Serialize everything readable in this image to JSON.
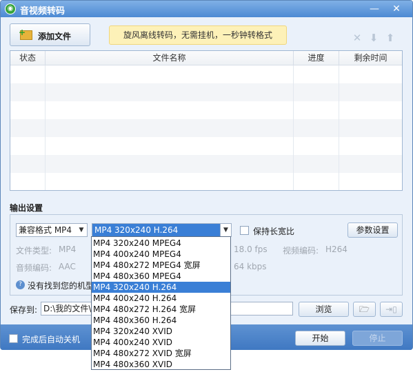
{
  "window": {
    "title": "音视频转码",
    "minimize_label": "—",
    "close_label": "✕"
  },
  "toolbar": {
    "add_files_label": "添加文件",
    "banner_text": "旋风离线转码，无需挂机，一秒钟转格式",
    "delete_icon": "close-icon",
    "move_down_icon": "arrow-down-icon",
    "move_up_icon": "arrow-up-icon"
  },
  "file_table": {
    "columns": [
      "状态",
      "文件名称",
      "进度",
      "剩余时间"
    ],
    "rows": []
  },
  "output_settings": {
    "section_title": "输出设置",
    "format_category": "兼容格式 MP4",
    "format_preset": "MP4 320x240 H.264",
    "keep_aspect_label": "保持长宽比",
    "params_button": "参数设置",
    "file_type_label": "文件类型:",
    "file_type_value": "MP4",
    "audio_codec_label": "音频编码:",
    "audio_codec_value": "AAC",
    "framerate_value": "18.0 fps",
    "video_codec_label": "视频编码:",
    "video_codec_value": "H264",
    "bitrate_value": "64 kbps",
    "help_text": "没有找到您的机型"
  },
  "save": {
    "label": "保存到:",
    "path": "D:\\我的文件\\",
    "browse_button": "浏览",
    "open_folder_icon": "folder-icon",
    "export_icon": "export-icon"
  },
  "bottom": {
    "auto_shutdown_label": "完成后自动关机",
    "start_button": "开始",
    "stop_button": "停止"
  },
  "preset_dropdown": {
    "selected_index": 4,
    "options": [
      "MP4 320x240 MPEG4",
      "MP4 400x240 MPEG4",
      "MP4 480x272 MPEG4 宽屏",
      "MP4 480x360 MPEG4",
      "MP4 320x240 H.264",
      "MP4 400x240 H.264",
      "MP4 480x272 H.264 宽屏",
      "MP4 480x360 H.264",
      "MP4 320x240 XVID",
      "MP4 400x240 XVID",
      "MP4 480x272 XVID 宽屏",
      "MP4 480x360 XVID"
    ]
  },
  "colors": {
    "title_bar": "#4d8ad3",
    "selection": "#3a7fd6",
    "banner": "#fdf1b8"
  }
}
